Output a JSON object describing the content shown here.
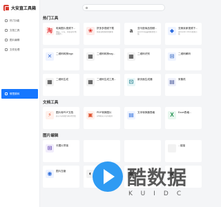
{
  "sidebar": {
    "brand": "大安直工具箱",
    "items": [
      {
        "label": "热门功能",
        "active": false
      },
      {
        "label": "文档工具",
        "active": false
      },
      {
        "label": "图片编辑",
        "active": false
      },
      {
        "label": "文件处理",
        "active": false
      },
      {
        "label": "哪里跳转",
        "active": true
      }
    ]
  },
  "search": {
    "placeholder": ""
  },
  "sections": [
    {
      "title": "热门工具",
      "cards": [
        {
          "title": "电商图片视频下...",
          "desc": "淘宝、京东、拼多多等电商图片...",
          "icon": "淘",
          "icon_color": "#e4393c",
          "icon_bg": "#fff1ef"
        },
        {
          "title": "拼多多视频下载",
          "desc": "拼多多视频在线解析",
          "icon": "❀",
          "icon_color": "#e02e24",
          "icon_bg": "#fdecea"
        },
        {
          "title": "亚马逊商品视频...",
          "desc": "Amazon商品视频在线下载",
          "icon": "a",
          "icon_color": "#222222",
          "icon_bg": "#ffffff"
        },
        {
          "title": "亚美卖家视频下...",
          "desc": "Alimaxdo Library视频下载",
          "icon": "◆",
          "icon_color": "#2d6cdf",
          "icon_bg": "#eef3ff"
        },
        {
          "title": "二维码转换logo",
          "desc": "",
          "icon": "✕",
          "icon_color": "#3b6fd4",
          "icon_bg": "#eef3ff"
        },
        {
          "title": "二维码转换svg...",
          "desc": "",
          "icon": "▦",
          "icon_color": "#333333",
          "icon_bg": "#f2f2f2"
        },
        {
          "title": "二维码识别",
          "desc": "",
          "icon": "▦",
          "icon_color": "#333333",
          "icon_bg": "#f2f2f2"
        },
        {
          "title": "二维码解码",
          "desc": "",
          "icon": "⊞",
          "icon_color": "#4a78c8",
          "icon_bg": "#eef3ff"
        },
        {
          "title": "二维码生成",
          "desc": "",
          "icon": "▦",
          "icon_color": "#333333",
          "icon_bg": "#f2f2f2"
        },
        {
          "title": "二维码生成工具...",
          "desc": "",
          "icon": "▦",
          "icon_color": "#333333",
          "icon_bg": "#f2f2f2"
        },
        {
          "title": "新页面生成器",
          "desc": "",
          "icon": "⊡",
          "icon_color": "#1e7d8c",
          "icon_bg": "#e8f6f7"
        },
        {
          "title": "采集机",
          "desc": "",
          "icon": "▤",
          "icon_color": "#4a5a9a",
          "icon_bg": "#eef0fa"
        }
      ]
    },
    {
      "title": "文档工具",
      "cards": [
        {
          "title": "图片转PDF文档",
          "desc": "jpg png等图片转pdf文档",
          "icon": "⚡",
          "icon_color": "#e0532f",
          "icon_bg": "#fff1ec"
        },
        {
          "title": "PDF转换图片",
          "desc": "pdf转jpg png等图片",
          "icon": "▣",
          "icon_color": "#e0532f",
          "icon_bg": "#fff1ec"
        },
        {
          "title": "文本转换器表格",
          "desc": "",
          "icon": "▤",
          "icon_color": "#2f6fdc",
          "icon_bg": "#eef3ff"
        },
        {
          "title": "Excel表格...",
          "desc": "",
          "icon": "X",
          "icon_color": "#1f8f4e",
          "icon_bg": "#e9f7ef"
        }
      ]
    },
    {
      "title": "图片编辑",
      "cards": [
        {
          "title": "长图片拼接",
          "desc": "",
          "icon": "⊞",
          "icon_color": "#6b4fb8",
          "icon_bg": "#f1edfb"
        },
        {
          "title": "",
          "desc": "",
          "icon": "",
          "icon_color": "#999999",
          "icon_bg": "#ffffff"
        },
        {
          "title": "",
          "desc": "",
          "icon": "",
          "icon_color": "#999999",
          "icon_bg": "#ffffff"
        },
        {
          "title": "...链接",
          "desc": "",
          "icon": "",
          "icon_color": "#999999",
          "icon_bg": "#f2f2f2"
        },
        {
          "title": "图片压缩",
          "desc": "",
          "icon": "◉",
          "icon_color": "#2f6fdc",
          "icon_bg": "#eef3ff"
        },
        {
          "title": "",
          "desc": "",
          "icon": "◐",
          "icon_color": "#333333",
          "icon_bg": "#f2f2f2"
        },
        {
          "title": "",
          "desc": "",
          "icon": "▣",
          "icon_color": "#333333",
          "icon_bg": "#f2f2f2"
        },
        {
          "title": "",
          "desc": "",
          "icon": "▣",
          "icon_color": "#333333",
          "icon_bg": "#f2f2f2"
        }
      ]
    }
  ],
  "watermark": {
    "main": "酷数据",
    "sub": "KUIDC"
  }
}
